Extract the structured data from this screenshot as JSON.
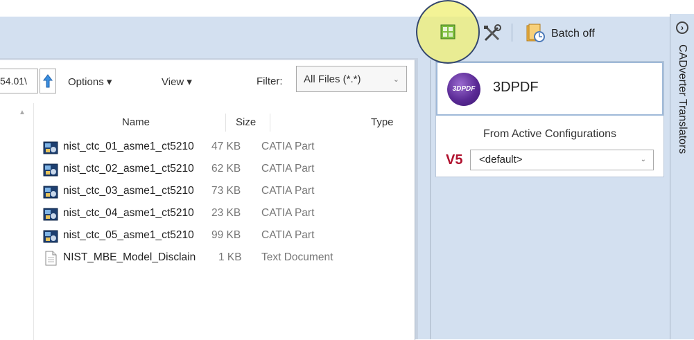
{
  "toolbar": {
    "icons": [
      "batch-grid-icon",
      "tools-icon",
      "batch-clock-icon"
    ],
    "batch_label": "Batch off"
  },
  "file_dialog": {
    "path_fragment": "54.01\\",
    "options_label": "Options ▾",
    "view_label": "View ▾",
    "filter_label": "Filter:",
    "filter_value": "All Files (*.*)",
    "columns": {
      "name": "Name",
      "size": "Size",
      "type": "Type"
    },
    "files": [
      {
        "name": "nist_ctc_01_asme1_ct5210",
        "size": "47 KB",
        "type": "CATIA Part",
        "icon": "catia-part-icon"
      },
      {
        "name": "nist_ctc_02_asme1_ct5210",
        "size": "62 KB",
        "type": "CATIA Part",
        "icon": "catia-part-icon"
      },
      {
        "name": "nist_ctc_03_asme1_ct5210",
        "size": "73 KB",
        "type": "CATIA Part",
        "icon": "catia-part-icon"
      },
      {
        "name": "nist_ctc_04_asme1_ct5210",
        "size": "23 KB",
        "type": "CATIA Part",
        "icon": "catia-part-icon"
      },
      {
        "name": "nist_ctc_05_asme1_ct5210",
        "size": "99 KB",
        "type": "CATIA Part",
        "icon": "catia-part-icon"
      },
      {
        "name": "NIST_MBE_Model_Disclain",
        "size": "1 KB",
        "type": "Text Document",
        "icon": "text-document-icon"
      }
    ]
  },
  "translator_card": {
    "logo_text": "3DPDF",
    "title": "3DPDF",
    "config_label": "From Active Configurations",
    "source_logo": "V5",
    "config_value": "<default>"
  },
  "side_tab": {
    "label": "CADverter Translators"
  },
  "colors": {
    "band": "#d3e0f0",
    "highlight": "#f0f078",
    "v5_red": "#b0112e",
    "logo_purple": "#5a2a95"
  }
}
